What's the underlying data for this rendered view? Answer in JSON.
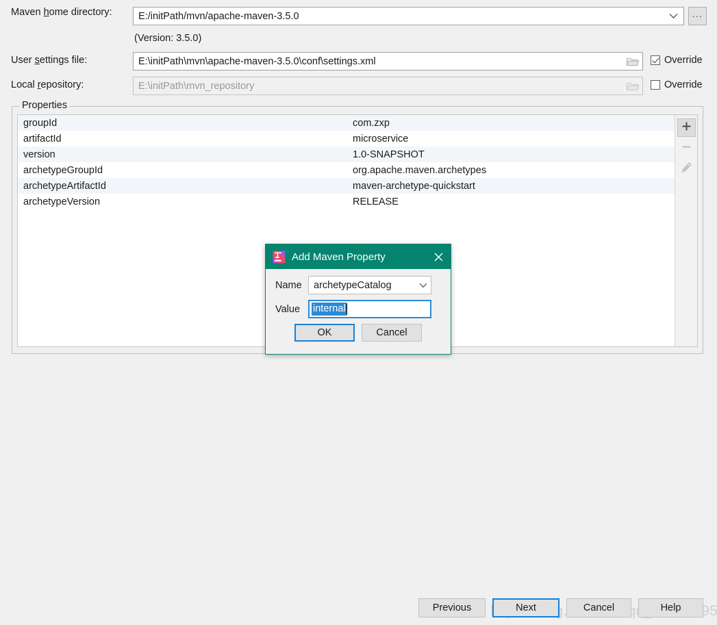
{
  "form": {
    "maven_home": {
      "label_pre": "Maven ",
      "label_mnemonic": "h",
      "label_post": "ome directory:",
      "value": "E:/initPath/mvn/apache-maven-3.5.0",
      "browse_label": "...",
      "version_note": "(Version: 3.5.0)"
    },
    "user_settings": {
      "label_pre": "User ",
      "label_mnemonic": "s",
      "label_post": "ettings file:",
      "value": "E:\\initPath\\mvn\\apache-maven-3.5.0\\conf\\settings.xml",
      "override_label": "Override",
      "override_checked": true
    },
    "local_repository": {
      "label_pre": "Local ",
      "label_mnemonic": "r",
      "label_post": "epository:",
      "value": "E:\\initPath\\mvn_repository",
      "override_label": "Override",
      "override_checked": false
    }
  },
  "properties": {
    "group_title": "Properties",
    "rows": [
      {
        "name": "groupId",
        "value": "com.zxp"
      },
      {
        "name": "artifactId",
        "value": "microservice"
      },
      {
        "name": "version",
        "value": "1.0-SNAPSHOT"
      },
      {
        "name": "archetypeGroupId",
        "value": "org.apache.maven.archetypes"
      },
      {
        "name": "archetypeArtifactId",
        "value": "maven-archetype-quickstart"
      },
      {
        "name": "archetypeVersion",
        "value": "RELEASE"
      }
    ],
    "toolbar": {
      "add": "+",
      "remove": "−",
      "edit": "edit"
    }
  },
  "wizard_buttons": {
    "previous": "Previous",
    "next": "Next",
    "cancel": "Cancel",
    "help": "Help"
  },
  "watermark": "https://blog.csdn.net/qq_45243895",
  "dialog": {
    "title": "Add Maven Property",
    "close": "✕",
    "name_label": "Name",
    "name_value": "archetypeCatalog",
    "value_label": "Value",
    "value_text": "internal",
    "ok": "OK",
    "cancel": "Cancel"
  },
  "colors": {
    "dialog_header": "#058470",
    "selection_blue": "#2a8ad4",
    "focus_blue": "#1a7fd4",
    "row_alt": "#f2f6fb",
    "window_bg": "#f0f0f0"
  }
}
